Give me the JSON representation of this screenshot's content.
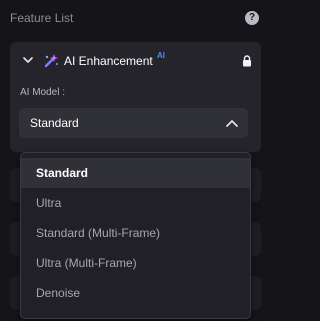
{
  "header": {
    "title": "Feature List",
    "help_symbol": "?"
  },
  "section": {
    "title": "AI Enhancement",
    "badge": "AI",
    "model_label": "AI Model :",
    "selected_model": "Standard"
  },
  "dropdown": {
    "options": [
      "Standard",
      "Ultra",
      "Standard (Multi-Frame)",
      "Ultra (Multi-Frame)",
      "Denoise"
    ]
  },
  "colors": {
    "background": "#151519",
    "card": "#24242a",
    "select": "#303037",
    "accent_ai": "#4f8dff",
    "icon_purple": "#8a5cff"
  },
  "icons": {
    "collapse": "chevron-down-icon",
    "feature": "ai-enhancement-icon",
    "locked": "lock-icon",
    "help": "help-icon",
    "dropdown_toggle": "chevron-up-icon"
  }
}
